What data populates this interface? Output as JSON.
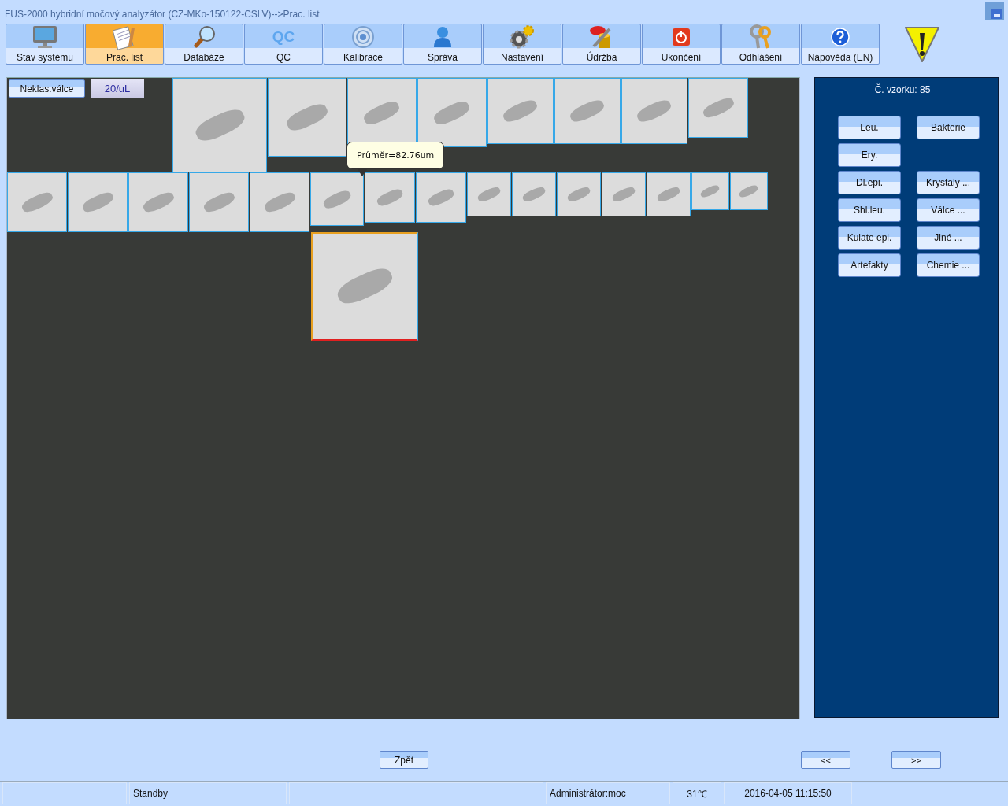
{
  "window": {
    "title": "FUS-2000 hybridní močový analyzátor (CZ-MKo-150122-CSLV)-->Prac. list"
  },
  "toolbar": [
    {
      "label": "Stav systému",
      "selected": false
    },
    {
      "label": "Prac. list",
      "selected": true
    },
    {
      "label": "Databáze",
      "selected": false
    },
    {
      "label": "QC",
      "icon_text": "QC",
      "selected": false
    },
    {
      "label": "Kalibrace",
      "selected": false
    },
    {
      "label": "Správa",
      "selected": false
    },
    {
      "label": "Nastavení",
      "selected": false
    },
    {
      "label": "Údržba",
      "selected": false
    },
    {
      "label": "Ukončení",
      "selected": false
    },
    {
      "label": "Odhlášení",
      "selected": false
    },
    {
      "label": "Nápověda (EN)",
      "selected": false
    }
  ],
  "viewer": {
    "category_button": "Neklas.válce",
    "concentration": "20/uL",
    "tooltip": "Průměr=82.76um",
    "image_rows": [
      [
        {
          "selected": false
        },
        {
          "selected": false
        },
        {
          "selected": false
        },
        {
          "selected": false
        },
        {
          "selected": false
        },
        {
          "selected": false
        },
        {
          "selected": false
        },
        {
          "selected": false
        }
      ],
      [
        {
          "selected": false
        },
        {
          "selected": false
        },
        {
          "selected": false
        },
        {
          "selected": false
        },
        {
          "selected": false
        },
        {
          "selected": false
        },
        {
          "selected": false
        },
        {
          "selected": false
        },
        {
          "selected": false
        },
        {
          "selected": false
        },
        {
          "selected": false
        },
        {
          "selected": false
        },
        {
          "selected": false
        },
        {
          "selected": false
        },
        {
          "selected": false
        }
      ],
      [
        {
          "selected": true
        }
      ]
    ]
  },
  "side_panel": {
    "sample_number": "Č. vzorku: 85",
    "button_rows": [
      [
        "Leu.",
        "Bakterie"
      ],
      [
        "Ery."
      ],
      [
        "Dl.epi.",
        "Krystaly ..."
      ],
      [
        "Shl.leu.",
        "Válce ..."
      ],
      [
        "Kulate epi.",
        "Jiné ..."
      ],
      [
        "Artefakty",
        "Chemie ..."
      ]
    ]
  },
  "navigation": {
    "back": "Zpět",
    "previous": "<<",
    "next": ">>"
  },
  "status_bar": {
    "state": "Standby",
    "user": "Administrátor:moc",
    "temperature": "31℃",
    "datetime": "2016-04-05 11:15:50"
  }
}
